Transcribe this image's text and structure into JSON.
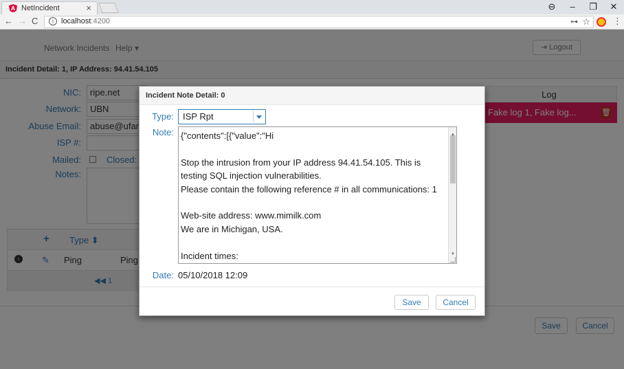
{
  "browser": {
    "tab_title": "NetIncident",
    "tab_close": "×",
    "url_host": "localhost",
    "url_port": ":4200",
    "controls": [
      "⊖",
      "–",
      "❐",
      "✕"
    ]
  },
  "app": {
    "nav": {
      "incidents": "Network Incidents",
      "help": "Help ▾",
      "logout": "⇥ Logout"
    },
    "detail_header": "Incident Detail: 1, IP Address: 94.41.54.105",
    "form": {
      "nic_label": "NIC:",
      "nic_value": "ripe.net",
      "network_label": "Network:",
      "network_value": "UBN",
      "abuse_label": "Abuse Email:",
      "abuse_value": "abuse@ufar",
      "isp_label": "ISP #:",
      "mailed_label": "Mailed:",
      "closed_label": "Closed:",
      "notes_label": "Notes:"
    },
    "log": {
      "header": "Log",
      "cell": "Fake log 1, Fake log..."
    },
    "grid": {
      "type_header": "Type ⬍",
      "row_type": "Ping",
      "row_desc": "Ping",
      "pager": "◀◀ 1"
    },
    "footer": {
      "save": "Save",
      "cancel": "Cancel"
    }
  },
  "modal": {
    "title": "Incident Note Detail: 0",
    "type_label": "Type:",
    "type_value": "ISP Rpt",
    "note_label": "Note:",
    "note_lines": [
      "{\"contents\":[{\"value\":\"Hi",
      "",
      "Stop the intrusion from your IP address 94.41.54.105.  This is",
      "testing SQL injection vulnerabilities.",
      "Please contain the following reference # in all communications: 1",
      "",
      "Web-site address: www.mimilk.com",
      "We are in Michigan, USA.",
      "",
      "Incident times:"
    ],
    "date_label": "Date:",
    "date_value": "05/10/2018 12:09",
    "save": "Save",
    "cancel": "Cancel"
  }
}
